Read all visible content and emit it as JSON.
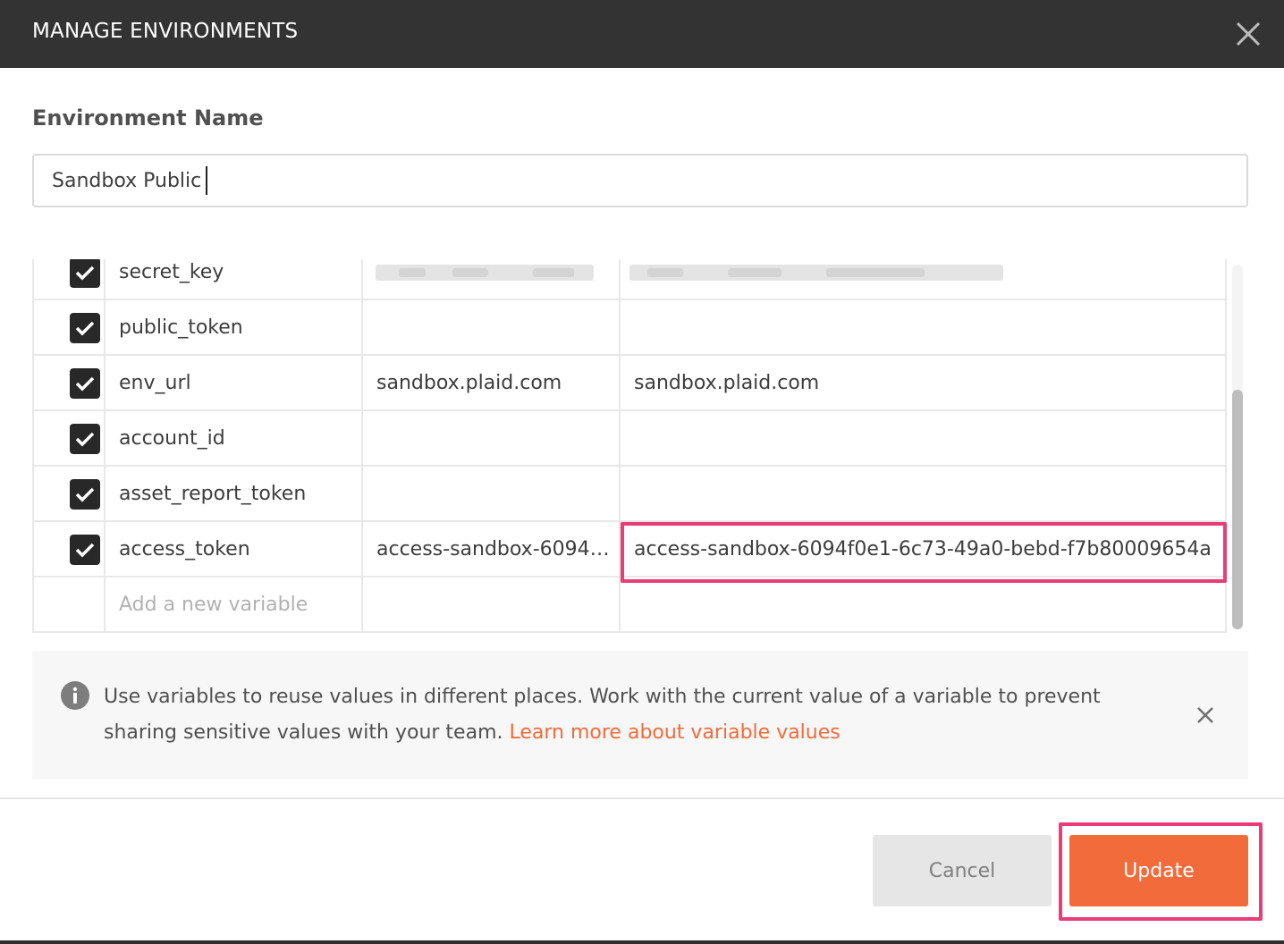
{
  "header": {
    "title": "MANAGE ENVIRONMENTS"
  },
  "environment": {
    "label": "Environment Name",
    "name_value": "Sandbox Public"
  },
  "variables": [
    {
      "enabled": true,
      "key": "secret_key",
      "initial_value": "",
      "current_value": "",
      "redacted": true
    },
    {
      "enabled": true,
      "key": "public_token",
      "initial_value": "",
      "current_value": ""
    },
    {
      "enabled": true,
      "key": "env_url",
      "initial_value": "sandbox.plaid.com",
      "current_value": "sandbox.plaid.com"
    },
    {
      "enabled": true,
      "key": "account_id",
      "initial_value": "",
      "current_value": ""
    },
    {
      "enabled": true,
      "key": "asset_report_token",
      "initial_value": "",
      "current_value": ""
    },
    {
      "enabled": true,
      "key": "access_token",
      "initial_value": "access-sandbox-6094…",
      "current_value": "access-sandbox-6094f0e1-6c73-49a0-bebd-f7b80009654a"
    }
  ],
  "new_variable_placeholder": "Add a new variable",
  "info": {
    "text": "Use variables to reuse values in different places. Work with the current value of a variable to prevent sharing sensitive values with your team.",
    "link": "Learn more about variable values"
  },
  "footer": {
    "cancel_label": "Cancel",
    "update_label": "Update"
  },
  "colors": {
    "header_bg": "#333333",
    "accent": "#f26b3a",
    "highlight": "#ea3c77"
  }
}
